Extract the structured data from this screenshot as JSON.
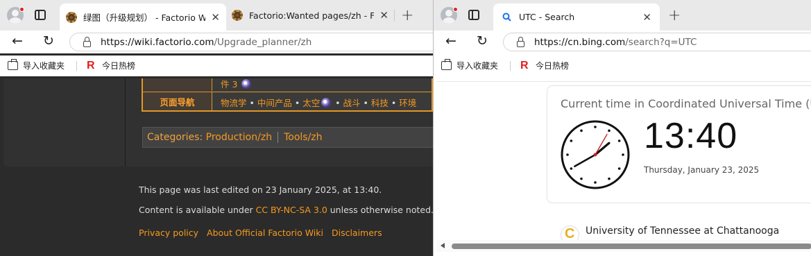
{
  "left": {
    "tabs": [
      {
        "title": "绿图（升级规划） - Factorio Wiki",
        "close": "✕"
      },
      {
        "title": "Factorio:Wanted pages/zh - Facto",
        "close": "✕"
      }
    ],
    "new_tab": "+",
    "address": {
      "domain": "https://wiki.factorio.com",
      "path": "/Upgrade_planner/zh"
    },
    "bookmarks": [
      "导入收藏夹",
      "今日热榜"
    ],
    "navbox": {
      "row1_value": "件 3",
      "row2_label": "页面导航",
      "row2_items": [
        "物流学",
        "中间产品",
        "太空",
        "战斗",
        "科技",
        "环境"
      ]
    },
    "categories": {
      "label": "Categories",
      "colon": ":",
      "items": [
        "Production/zh",
        "Tools/zh"
      ]
    },
    "footer": {
      "last_edited": "This page was last edited on 23 January 2025, at 13:40.",
      "content_prefix": "Content is available under ",
      "license": "CC BY-NC-SA 3.0",
      "content_suffix": " unless otherwise noted.",
      "links": [
        "Privacy policy",
        "About Official Factorio Wiki",
        "Disclaimers"
      ]
    }
  },
  "right": {
    "tab": {
      "title": "UTC - Search",
      "close": "✕"
    },
    "new_tab": "+",
    "address": {
      "domain": "https://cn.bing.com",
      "path": "/search?q=UTC"
    },
    "bookmarks": [
      "导入收藏夹",
      "今日热榜"
    ],
    "card": {
      "title": "Current time in Coordinated Universal Time (UTC)",
      "time": "13:40",
      "date": "Thursday, January 23, 2025"
    },
    "clock": {
      "hour": 13,
      "minute": 40,
      "second": 5
    },
    "result": {
      "name": "University of Tennessee at Chattanooga"
    }
  },
  "icons": {
    "back": "←",
    "reload": "↻"
  },
  "colors": {
    "wiki_accent": "#f79a1f",
    "navbox_border": "#e39827",
    "bing_blue": "#1a73e8"
  }
}
